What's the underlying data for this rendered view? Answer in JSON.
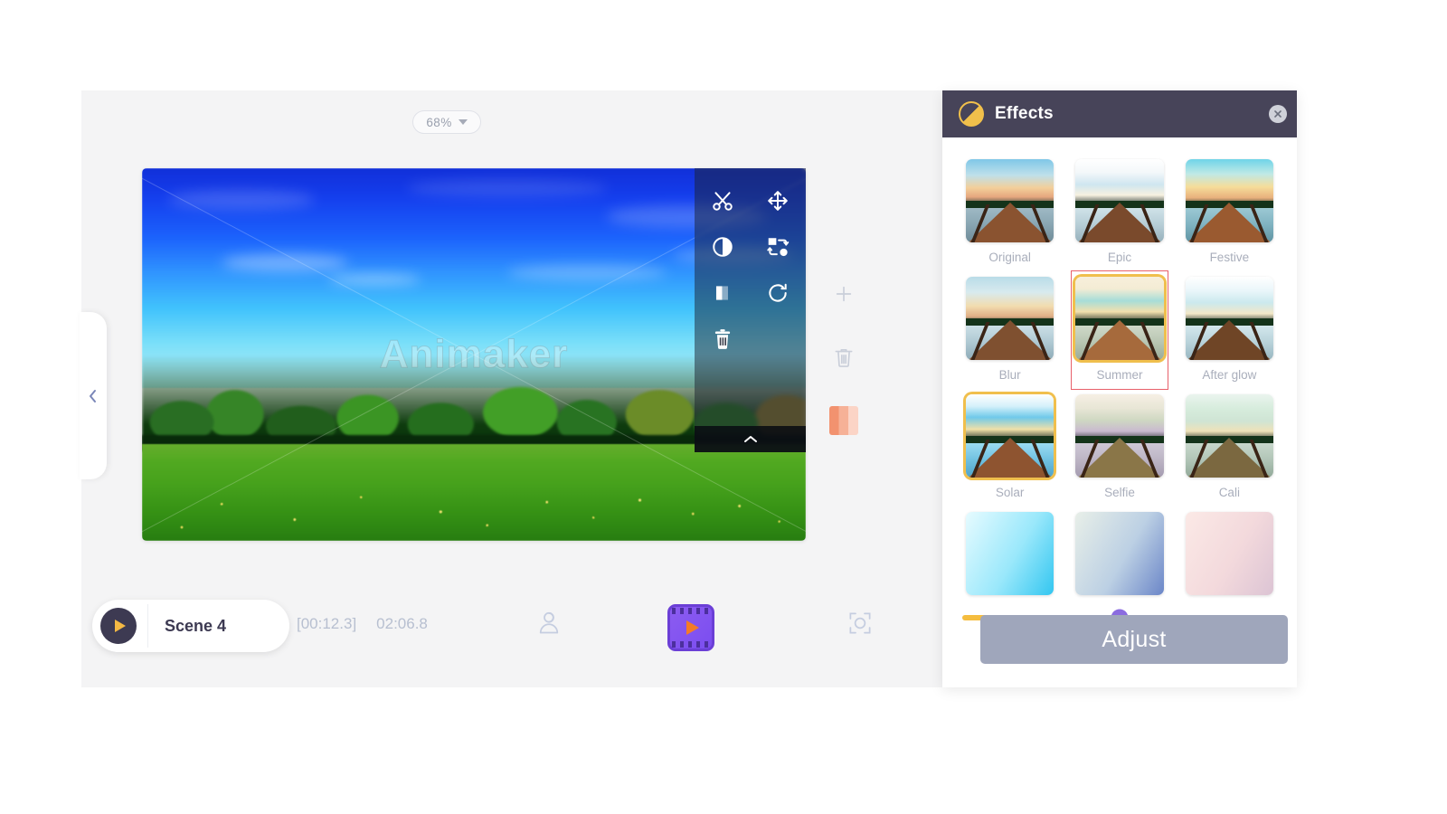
{
  "editor": {
    "zoom": {
      "value": "68%",
      "icon": "chevron-down-icon"
    },
    "canvas": {
      "watermark": "Animaker"
    },
    "element_toolbar": {
      "buttons": [
        {
          "name": "cut",
          "icon": "scissors-icon"
        },
        {
          "name": "move",
          "icon": "move-arrows-icon"
        },
        {
          "name": "contrast",
          "icon": "contrast-circle-icon"
        },
        {
          "name": "replace",
          "icon": "swap-shapes-icon"
        },
        {
          "name": "crop",
          "icon": "split-rectangle-icon"
        },
        {
          "name": "rotate",
          "icon": "rotate-cw-icon"
        },
        {
          "name": "delete",
          "icon": "trash-icon"
        }
      ],
      "collapse_icon": "chevron-up-icon"
    },
    "rail": [
      {
        "name": "add",
        "icon": "plus-icon"
      },
      {
        "name": "delete",
        "icon": "trash-icon"
      },
      {
        "name": "color",
        "icon": "color-swatch"
      }
    ],
    "left_tab": {
      "icon": "chevron-left-icon"
    }
  },
  "bottom_bar": {
    "play_icon": "play-icon",
    "scene_name": "Scene 4",
    "current_time": "[00:12.3]",
    "total_time": "02:06.8",
    "icons": [
      {
        "name": "character",
        "icon": "person-icon"
      },
      {
        "name": "video",
        "icon": "film-play-icon"
      },
      {
        "name": "focus",
        "icon": "focus-frame-icon"
      }
    ]
  },
  "effects_panel": {
    "title": "Effects",
    "header_icon": "contrast-circle-icon",
    "close_icon": "close-icon",
    "effects": [
      {
        "label": "Original",
        "selected": false,
        "highlighted": false
      },
      {
        "label": "Epic",
        "selected": false,
        "highlighted": false
      },
      {
        "label": "Festive",
        "selected": false,
        "highlighted": false
      },
      {
        "label": "Blur",
        "selected": false,
        "highlighted": false
      },
      {
        "label": "Summer",
        "selected": true,
        "highlighted": true
      },
      {
        "label": "After glow",
        "selected": false,
        "highlighted": false
      },
      {
        "label": "Solar",
        "selected": true,
        "highlighted": false
      },
      {
        "label": "Selfie",
        "selected": false,
        "highlighted": false
      },
      {
        "label": "Cali",
        "selected": false,
        "highlighted": false
      }
    ],
    "intensity": {
      "value": 50
    },
    "adjust_label": "Adjust"
  },
  "colors": {
    "panel_header": "#474459",
    "accent_yellow": "#f5bd3f",
    "accent_purple": "#8b6ce0",
    "highlight_red": "#e8606a",
    "adjust_button": "#9fa6bb",
    "editor_bg": "#f4f4f5"
  }
}
